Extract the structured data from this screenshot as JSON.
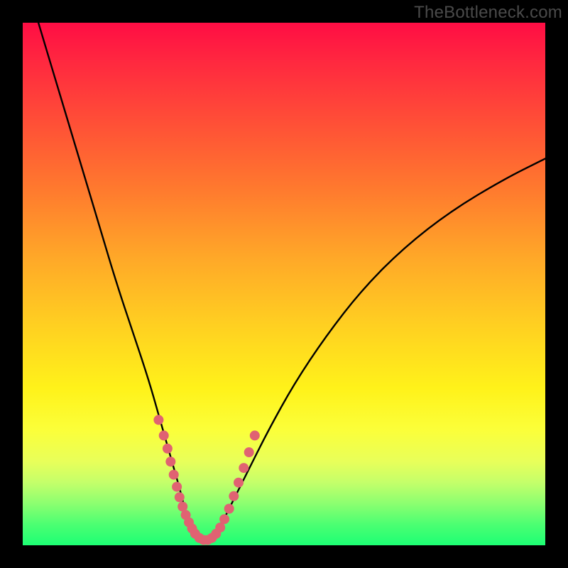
{
  "watermark": "TheBottleneck.com",
  "colors": {
    "background": "#000000",
    "curve": "#000000",
    "marker_fill": "#e06272",
    "gradient_stops": [
      "#ff0d44",
      "#ff7a2e",
      "#ffd021",
      "#fff21a",
      "#4cff72",
      "#1dff74"
    ]
  },
  "chart_data": {
    "type": "line",
    "title": "",
    "xlabel": "",
    "ylabel": "",
    "xlim": [
      0,
      100
    ],
    "ylim": [
      0,
      100
    ],
    "grid": false,
    "legend": false,
    "annotations": [
      "TheBottleneck.com"
    ],
    "series": [
      {
        "name": "bottleneck-curve",
        "x": [
          3,
          6,
          9,
          12,
          15,
          18,
          21,
          24,
          26,
          28,
          30,
          31,
          32,
          33,
          34,
          35,
          36,
          38,
          40,
          43,
          47,
          52,
          58,
          65,
          73,
          82,
          92,
          100
        ],
        "y": [
          100,
          90,
          80,
          70,
          60,
          50,
          41,
          32,
          25,
          18,
          11,
          7,
          4,
          2,
          1,
          1,
          2,
          4,
          8,
          14,
          22,
          31,
          40,
          49,
          57,
          64,
          70,
          74
        ]
      }
    ],
    "markers": {
      "name": "highlight-dots",
      "x": [
        26,
        27,
        27.7,
        28.3,
        28.9,
        29.5,
        30.0,
        30.6,
        31.2,
        31.8,
        32.4,
        33.0,
        33.8,
        34.6,
        35.4,
        36.2,
        37.0,
        37.8,
        38.6,
        39.5,
        40.4,
        41.3,
        42.3,
        43.3,
        44.4
      ],
      "y": [
        24,
        21,
        18.5,
        16,
        13.5,
        11.2,
        9.2,
        7.4,
        5.8,
        4.4,
        3.2,
        2.2,
        1.4,
        1.0,
        1.0,
        1.4,
        2.2,
        3.4,
        5.0,
        7.0,
        9.4,
        12.0,
        14.8,
        17.8,
        21.0
      ]
    }
  }
}
